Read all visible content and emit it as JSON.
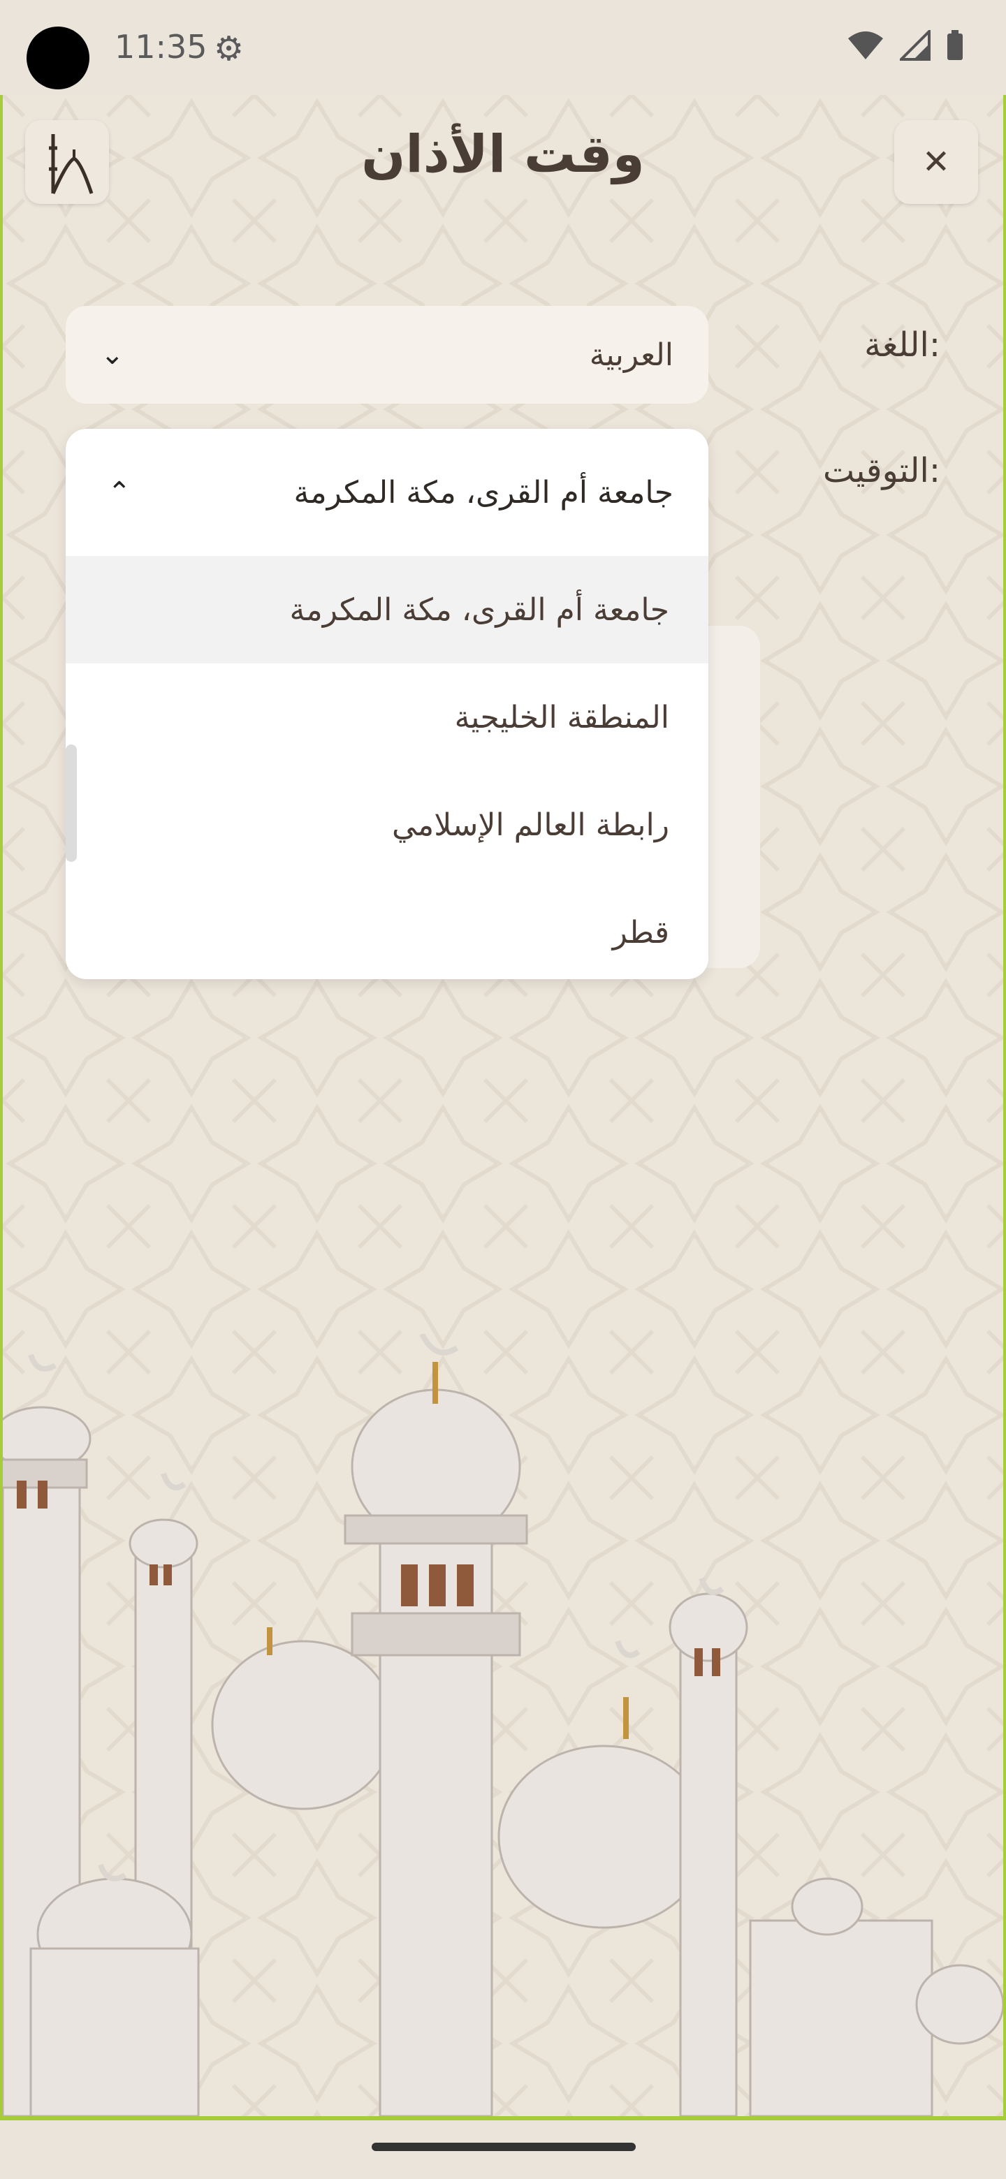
{
  "status_bar": {
    "time": "11:35"
  },
  "header": {
    "title": "وقت الأذان"
  },
  "settings": {
    "language_label": "اللغة:",
    "language_value": "العربية",
    "timing_label": "التوقيت:",
    "timing_value": "جامعة أم القرى، مكة المكرمة"
  },
  "dropdown": {
    "options": [
      "جامعة أم القرى، مكة المكرمة",
      "المنطقة الخليجية",
      "رابطة العالم الإسلامي",
      "قطر"
    ]
  },
  "icons": {
    "close": "close-icon",
    "logo": "mosque-logo-icon",
    "settings": "gear-icon",
    "expand": "chevron-down-icon",
    "collapse": "chevron-up-icon"
  },
  "colors": {
    "accent": "#a7cc3a",
    "text": "#4a3d36",
    "background": "#ece5da"
  }
}
